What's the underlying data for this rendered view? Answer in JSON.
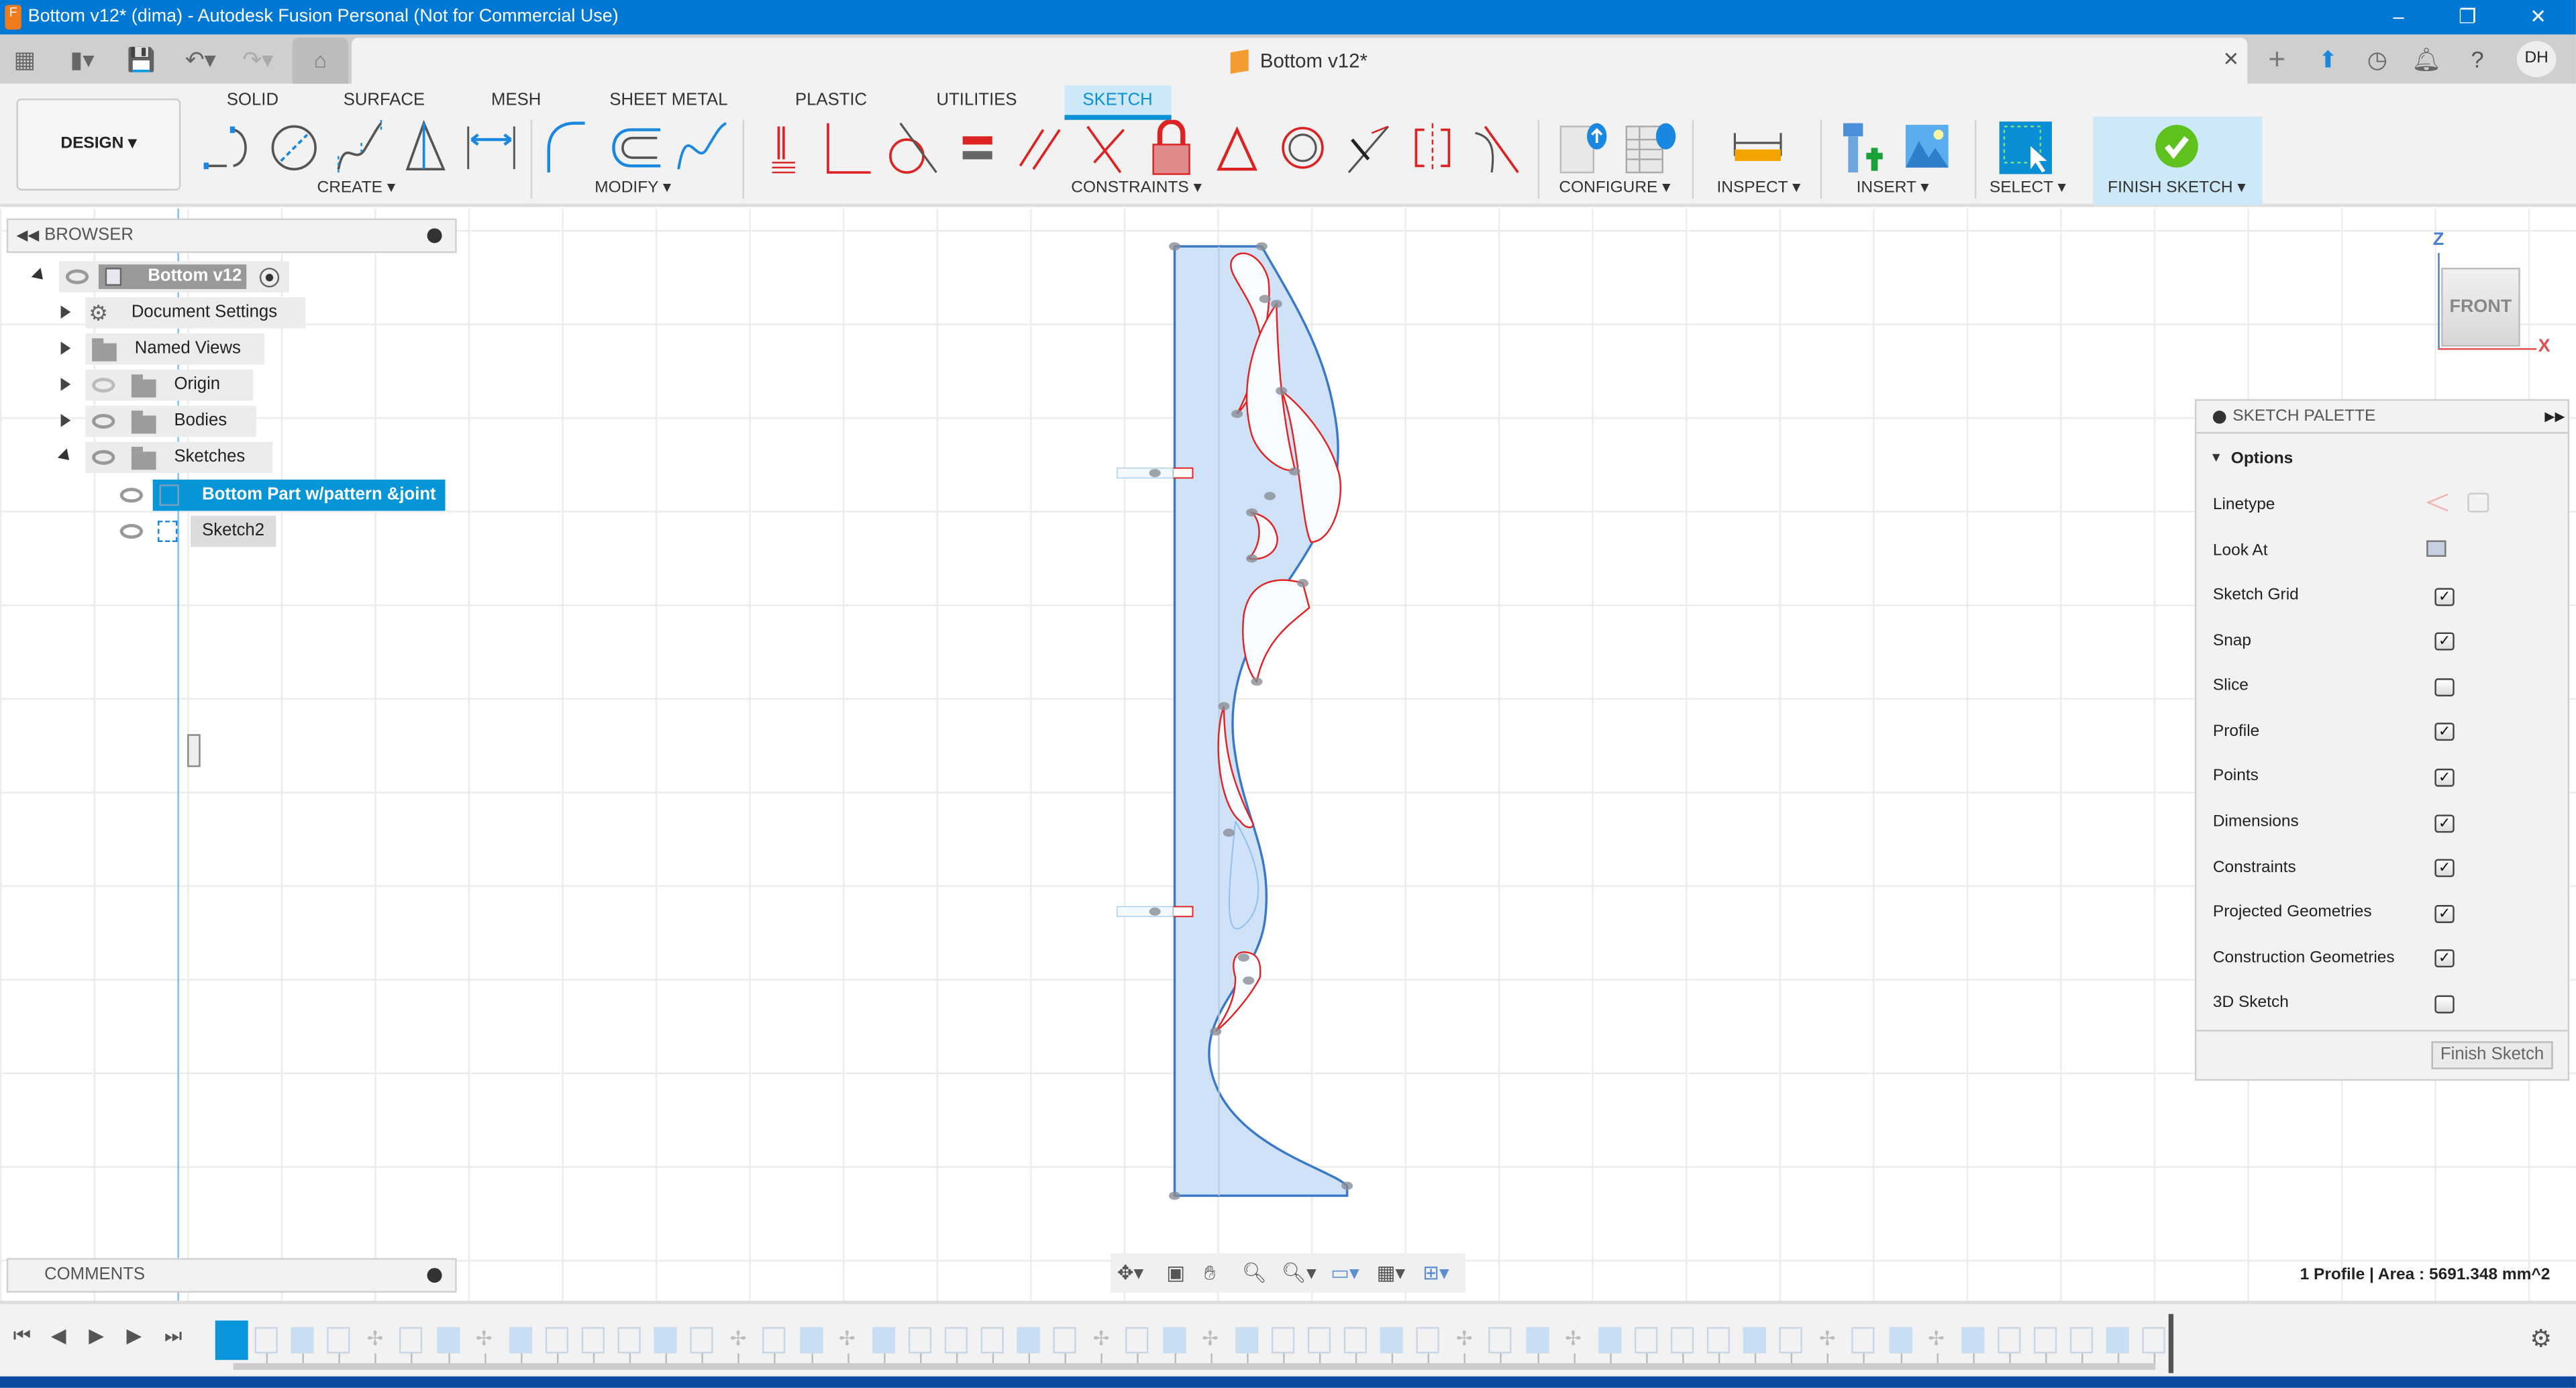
{
  "window": {
    "title": "Bottom v12* (dima) - Autodesk Fusion Personal (Not for Commercial Use)",
    "app_logo": "F",
    "minimize": "–",
    "restore": "❐",
    "close": "✕"
  },
  "document_tab": {
    "title": "Bottom v12*",
    "close": "✕"
  },
  "user": {
    "initials": "DH"
  },
  "ribbon": {
    "workspace": "DESIGN ▾",
    "tabs": [
      "SOLID",
      "SURFACE",
      "MESH",
      "SHEET METAL",
      "PLASTIC",
      "UTILITIES",
      "SKETCH"
    ],
    "active_tab": "SKETCH",
    "groups": {
      "create": "CREATE ▾",
      "modify": "MODIFY ▾",
      "constraints": "CONSTRAINTS ▾",
      "configure": "CONFIGURE ▾",
      "inspect": "INSPECT ▾",
      "insert": "INSERT ▾",
      "select": "SELECT ▾",
      "finish": "FINISH SKETCH ▾"
    }
  },
  "browser": {
    "title": "BROWSER",
    "root": "Bottom v12",
    "items": [
      {
        "label": "Document Settings",
        "icon": "gear-icon"
      },
      {
        "label": "Named Views",
        "icon": "folder-icon"
      },
      {
        "label": "Origin",
        "icon": "folder-icon",
        "hidden": true
      },
      {
        "label": "Bodies",
        "icon": "folder-icon"
      },
      {
        "label": "Sketches",
        "icon": "folder-icon",
        "expanded": true
      }
    ],
    "sketches": [
      {
        "label": "Bottom Part w/pattern &joint",
        "selected": true
      },
      {
        "label": "Sketch2",
        "selected": false
      }
    ]
  },
  "comments": {
    "title": "COMMENTS"
  },
  "viewcube": {
    "face": "FRONT",
    "axis_z": "Z",
    "axis_x": "X"
  },
  "sketch_palette": {
    "title": "SKETCH PALETTE",
    "section": "Options",
    "linetype_label": "Linetype",
    "look_at_label": "Look At",
    "options": [
      {
        "label": "Sketch Grid",
        "checked": true
      },
      {
        "label": "Snap",
        "checked": true
      },
      {
        "label": "Slice",
        "checked": false
      },
      {
        "label": "Profile",
        "checked": true
      },
      {
        "label": "Points",
        "checked": true
      },
      {
        "label": "Dimensions",
        "checked": true
      },
      {
        "label": "Constraints",
        "checked": true
      },
      {
        "label": "Projected Geometries",
        "checked": true
      },
      {
        "label": "Construction Geometries",
        "checked": true
      },
      {
        "label": "3D Sketch",
        "checked": false
      }
    ],
    "finish_button": "Finish Sketch"
  },
  "status": {
    "selection": "1 Profile | Area : 5691.348 mm^2"
  },
  "colors": {
    "accent": "#0696d7",
    "titlebar": "#0078d4",
    "profile_fill": "#cfe2f8",
    "profile_line": "#3a78c9",
    "constraint_red": "#e32222",
    "finish_green": "#5fc11e"
  }
}
